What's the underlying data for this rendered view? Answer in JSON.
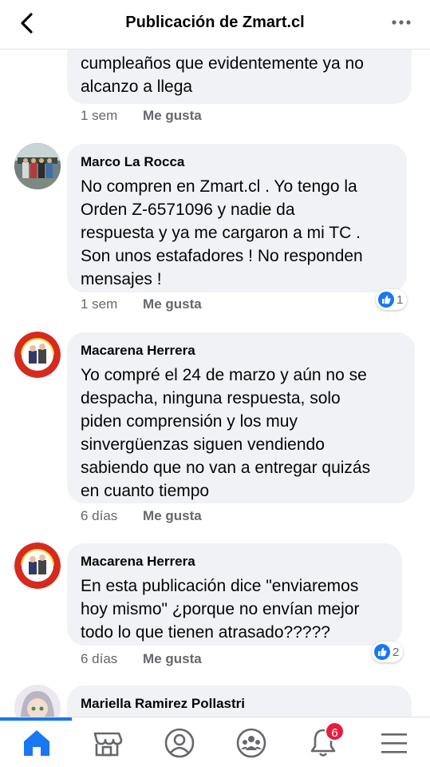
{
  "header": {
    "title": "Publicación de Zmart.cl"
  },
  "comments": [
    {
      "author": "",
      "text": "cumpleaños que evidentemente ya no\nalcanzo a llega",
      "time": "1 sem",
      "like_label": "Me gusta"
    },
    {
      "author": "Marco La Rocca",
      "text": "No compren en Zmart.cl . Yo tengo la\nOrden Z-6571096 y nadie da\nrespuesta y ya me cargaron a mi TC .\nSon unos estafadores ! No responden\nmensajes !",
      "time": "1 sem",
      "like_label": "Me gusta",
      "reaction_count": "1"
    },
    {
      "author": "Macarena Herrera",
      "text": "Yo compré el 24 de marzo y aún no se\ndespacha, ninguna respuesta, solo\npiden comprensión y los muy\nsinvergüenzas siguen vendiendo\nsabiendo que no van a entregar quizás\nen cuanto tiempo",
      "time": "6 días",
      "like_label": "Me gusta"
    },
    {
      "author": "Macarena Herrera",
      "text": "En esta publicación dice \"enviaremos\nhoy mismo\" ¿porque no envían mejor\ntodo lo que tienen atrasado?????",
      "time": "6 días",
      "like_label": "Me gusta",
      "reaction_count": "2"
    },
    {
      "author": "Mariella Ramirez Pollastri",
      "text": ""
    }
  ],
  "nav": {
    "items": [
      "home-icon",
      "marketplace-icon",
      "profile-icon",
      "groups-icon",
      "notifications-icon",
      "menu-icon"
    ],
    "notification_count": "6",
    "accent": "#1877f2"
  }
}
